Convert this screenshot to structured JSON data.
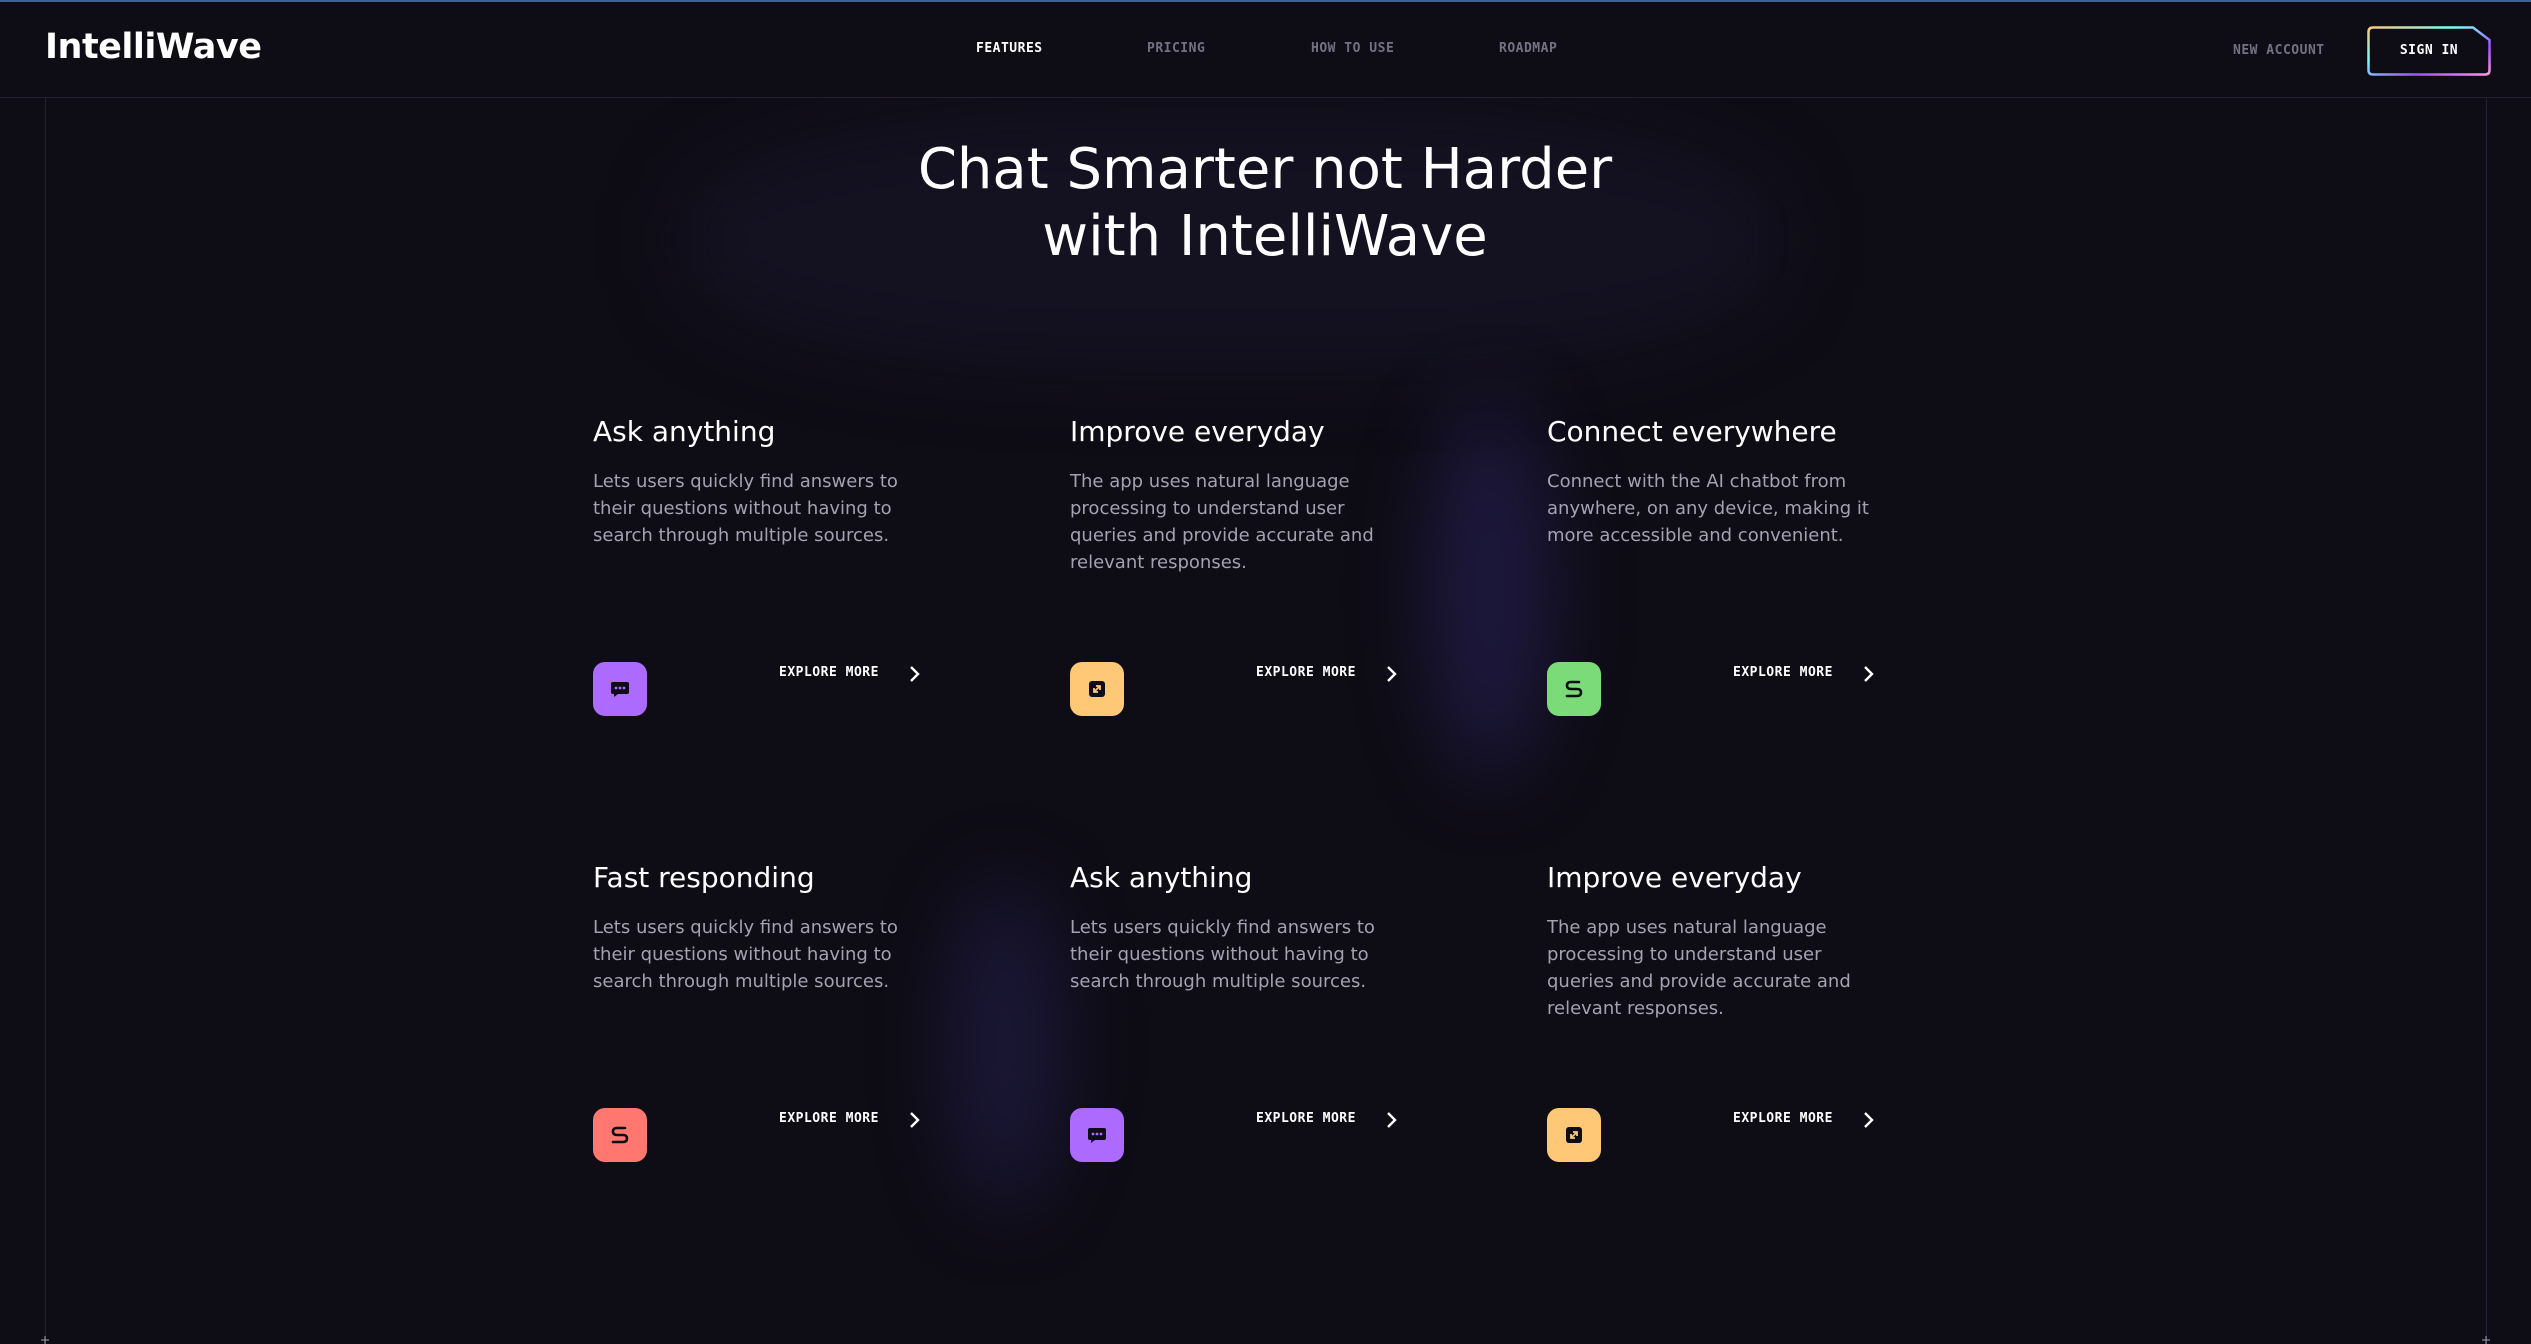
{
  "app": {
    "logo": "IntelliWave"
  },
  "nav": {
    "items": [
      {
        "label": "FEATURES",
        "active": true
      },
      {
        "label": "PRICING",
        "active": false
      },
      {
        "label": "HOW TO USE",
        "active": false
      },
      {
        "label": "ROADMAP",
        "active": false
      }
    ],
    "new_account": "NEW ACCOUNT",
    "sign_in": "SIGN IN"
  },
  "hero": {
    "title_line_1": "Chat Smarter not Harder",
    "title_line_2": "with IntelliWave"
  },
  "features": [
    {
      "title": "Ask anything",
      "text": "Lets users quickly find answers to their questions without having to search through multiple sources.",
      "cta": "EXPLORE MORE",
      "icon": "chat-bubble-icon",
      "icon_color": "#ac6aff"
    },
    {
      "title": "Improve everyday",
      "text": "The app uses natural language processing to understand user queries and provide accurate and relevant responses.",
      "cta": "EXPLORE MORE",
      "icon": "expand-icon",
      "icon_color": "#ffc876"
    },
    {
      "title": "Connect everywhere",
      "text": "Connect with the AI chatbot from anywhere, on any device, making it more accessible and convenient.",
      "cta": "EXPLORE MORE",
      "icon": "route-icon",
      "icon_color": "#7adb78"
    },
    {
      "title": "Fast responding",
      "text": "Lets users quickly find answers to their questions without having to search through multiple sources.",
      "cta": "EXPLORE MORE",
      "icon": "route-icon",
      "icon_color": "#ff776f"
    },
    {
      "title": "Ask anything",
      "text": "Lets users quickly find answers to their questions without having to search through multiple sources.",
      "cta": "EXPLORE MORE",
      "icon": "chat-bubble-icon",
      "icon_color": "#ac6aff"
    },
    {
      "title": "Improve everyday",
      "text": "The app uses natural language processing to understand user queries and provide accurate and relevant responses.",
      "cta": "EXPLORE MORE",
      "icon": "expand-icon",
      "icon_color": "#ffc876"
    }
  ],
  "colors": {
    "background": "#0e0c15",
    "muted_text": "#757185",
    "body_text": "#a4a1b3",
    "border": "#252134"
  }
}
